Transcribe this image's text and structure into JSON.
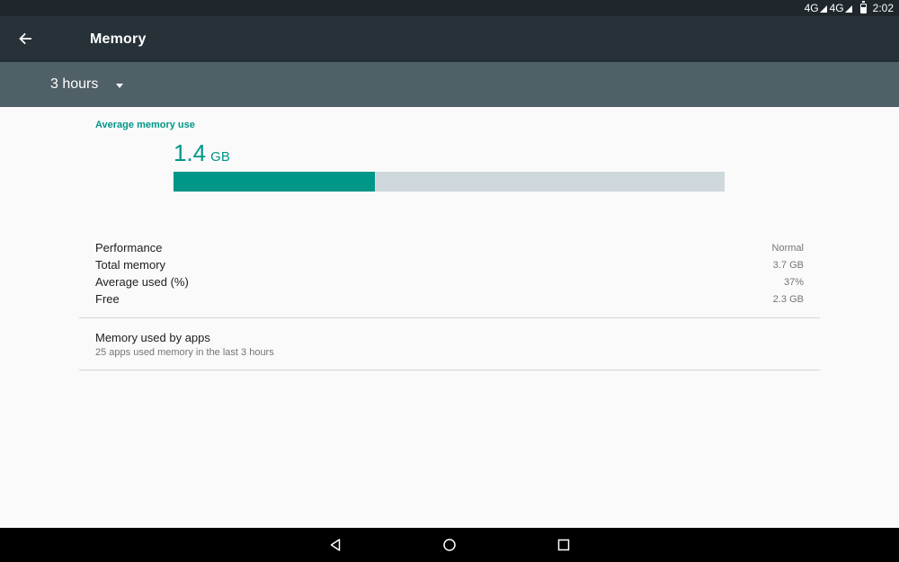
{
  "status_bar": {
    "network_1": "4G",
    "network_2": "4G",
    "time": "2:02"
  },
  "app_bar": {
    "title": "Memory",
    "back_icon": "arrow-back-icon"
  },
  "filter": {
    "selected": "3 hours",
    "dropdown_icon": "caret-down-icon"
  },
  "memory": {
    "average_label": "Average memory use",
    "average_value": "1.4",
    "average_unit": "GB",
    "usage_fraction": 0.366,
    "bar_colors": {
      "fill": "#009688",
      "track": "#cfd8dc"
    }
  },
  "stats": [
    {
      "label": "Performance",
      "value": "Normal"
    },
    {
      "label": "Total memory",
      "value": "3.7 GB"
    },
    {
      "label": "Average used (%)",
      "value": "37%"
    },
    {
      "label": "Free",
      "value": "2.3 GB"
    }
  ],
  "apps_item": {
    "title": "Memory used by apps",
    "subtitle": "25 apps used memory in the last 3 hours"
  },
  "nav_bar": {
    "icons": [
      "nav-back-icon",
      "nav-home-icon",
      "nav-recents-icon"
    ]
  },
  "colors": {
    "accent": "#009688",
    "status_bar": "#1f272c",
    "app_bar": "#263238",
    "filter_bar": "#4f6066"
  }
}
